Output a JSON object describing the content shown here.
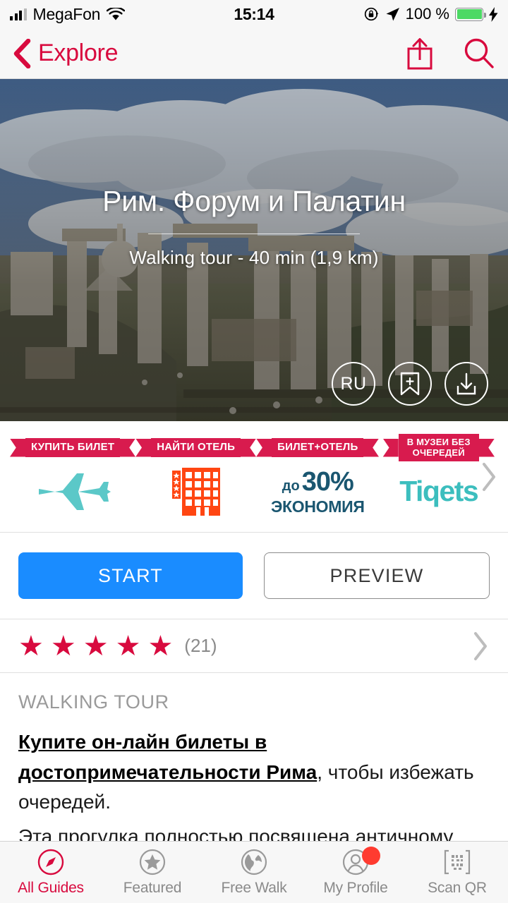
{
  "statusbar": {
    "carrier": "MegaFon",
    "time": "15:14",
    "battery_pct": "100 %",
    "icons": [
      "signal-bars-icon",
      "wifi-icon",
      "rotation-lock-icon",
      "location-arrow-icon",
      "battery-icon",
      "charging-bolt-icon"
    ]
  },
  "navbar": {
    "back_label": "Explore",
    "accent_color": "#d80a3e",
    "actions": [
      "share-icon",
      "search-icon"
    ]
  },
  "hero": {
    "title": "Рим. Форум и Палатин",
    "subtitle": "Walking tour - 40 min (1,9 km)",
    "buttons": [
      {
        "name": "language-button",
        "label": "RU"
      },
      {
        "name": "bookmark-add-button",
        "label": ""
      },
      {
        "name": "download-button",
        "label": ""
      }
    ]
  },
  "banners": {
    "items": [
      {
        "ribbon": "КУПИТЬ БИЛЕТ",
        "art": "airplane-icon",
        "color": "#5bc8c8"
      },
      {
        "ribbon": "НАЙТИ ОТЕЛЬ",
        "art": "hotel-icon",
        "color": "#ff4612"
      },
      {
        "ribbon": "БИЛЕТ+ОТЕЛЬ",
        "art": "savings-text",
        "prefix": "до",
        "percent": "30%",
        "word": "ЭКОНОМИЯ",
        "color": "#1a5670"
      },
      {
        "ribbon": "В МУЗЕИ БЕЗ ОЧЕРЕДЕЙ",
        "art": "tiqets-logo",
        "logo": "Tiqets",
        "color": "#3cbebe"
      }
    ],
    "next_icon": "chevron-right-icon"
  },
  "actions": {
    "start_label": "START",
    "preview_label": "PREVIEW",
    "start_color": "#1a8cff"
  },
  "rating": {
    "stars_filled": 5,
    "star_glyph": "★",
    "count_label": "(21)",
    "star_color": "#d80a3e"
  },
  "description": {
    "kicker": "WALKING TOUR",
    "link_text": "Купите он-лайн билеты в достопримечательности Рима",
    "after_link": ", чтобы избежать очередей.",
    "paragraph": "Эта прогулка полностью посвящена античному Риму. Форум и Палатин, несмотря на прошедшие"
  },
  "tabbar": {
    "items": [
      {
        "label": "All Guides",
        "icon": "compass-icon",
        "active": true,
        "badge": false
      },
      {
        "label": "Featured",
        "icon": "star-circle-icon",
        "active": false,
        "badge": false
      },
      {
        "label": "Free Walk",
        "icon": "globe-icon",
        "active": false,
        "badge": false
      },
      {
        "label": "My Profile",
        "icon": "person-circle-icon",
        "active": false,
        "badge": true
      },
      {
        "label": "Scan QR",
        "icon": "qr-code-icon",
        "active": false,
        "badge": false
      }
    ]
  }
}
